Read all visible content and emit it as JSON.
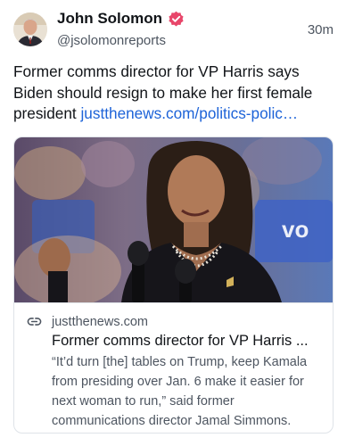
{
  "author": {
    "name": "John Solomon",
    "handle": "@jsolomonreports",
    "verified": true,
    "verified_color": "#e8466a"
  },
  "post": {
    "time": "30m",
    "text": "Former comms director for VP Harris says Biden should resign to make her first female president ",
    "link_text": "justthenews.com/politics-polic…",
    "link_color": "#1d63d8"
  },
  "card": {
    "domain": "justthenews.com",
    "title": "Former comms director for VP Harris ...",
    "description": "“It’d turn [the] tables on Trump, keep Kamala from presiding over Jan. 6 make it easier for next woman to run,” said former communications director Jamal Simmons."
  }
}
